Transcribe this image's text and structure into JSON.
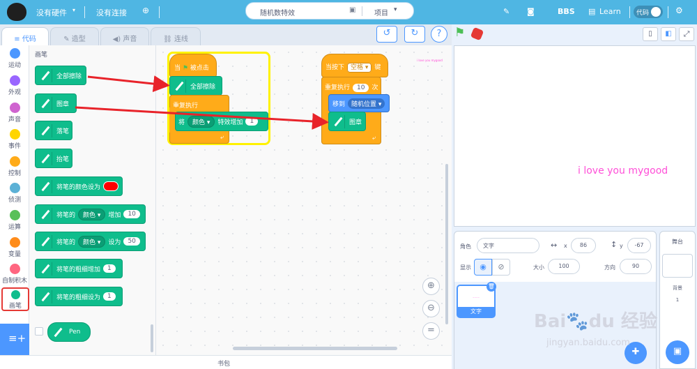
{
  "menu": {
    "hardware": "没有硬件",
    "connection": "没有连接",
    "project_title": "随机数特效",
    "project_menu": "项目",
    "bbs": "BBS",
    "learn": "Learn",
    "mode": "代码"
  },
  "tabs": {
    "code": "代码",
    "costumes": "造型",
    "sounds": "声音",
    "connect": "连线"
  },
  "categories": [
    {
      "label": "运动",
      "color": "#4c97ff"
    },
    {
      "label": "外观",
      "color": "#9966ff"
    },
    {
      "label": "声音",
      "color": "#cf63cf"
    },
    {
      "label": "事件",
      "color": "#ffd500"
    },
    {
      "label": "控制",
      "color": "#ffab19"
    },
    {
      "label": "侦测",
      "color": "#5cb1d6"
    },
    {
      "label": "运算",
      "color": "#59c059"
    },
    {
      "label": "变量",
      "color": "#ff8c1a"
    },
    {
      "label": "自制积木",
      "color": "#ff6680"
    },
    {
      "label": "画笔",
      "color": "#0fbd8c"
    }
  ],
  "palette": {
    "title": "画笔",
    "clear": "全部擦除",
    "stamp": "图章",
    "pen_down": "落笔",
    "pen_up": "抬笔",
    "set_color": "将笔的颜色设为",
    "change_prefix": "将笔的",
    "color_param": "颜色",
    "change_by": "增加",
    "change_val": "10",
    "set_to": "设为",
    "set_val": "50",
    "size_change": "将笔的粗细增加",
    "size_change_val": "1",
    "size_set": "将笔的粗细设为",
    "size_set_val": "1",
    "ext_pen": "Pen",
    "pen_color_value": "#ff0000"
  },
  "script1": {
    "hat_when": "当",
    "hat_clicked": "被点击",
    "clear": "全部擦除",
    "forever": "重复执行",
    "effect_prefix": "将",
    "effect_param": "颜色",
    "effect_by": "特效增加",
    "effect_val": "1"
  },
  "script2": {
    "hat_when": "当按下",
    "key": "空格",
    "hat_key": "键",
    "repeat": "重复执行",
    "repeat_val": "10",
    "repeat_times": "次",
    "goto": "移到",
    "goto_target": "随机位置",
    "stamp": "图章"
  },
  "stage": {
    "text": "i love you mygood",
    "text_color": "#ff4fd8"
  },
  "sprite_info": {
    "sprite_label": "角色",
    "sprite_name": "文字",
    "x_label": "x",
    "x_value": "86",
    "y_label": "y",
    "y_value": "-67",
    "show_label": "显示",
    "size_label": "大小",
    "size_value": "100",
    "direction_label": "方向",
    "direction_value": "90"
  },
  "sprite_thumb": {
    "name": "文字"
  },
  "stage_panel": {
    "title": "舞台",
    "backdrop_label": "背景",
    "backdrop_count": "1"
  },
  "backpack": {
    "label": "书包"
  },
  "watermark": {
    "line1": "Bai",
    "line2": "du",
    "line3": "经验",
    "line4": "jingyan.baidu.com"
  }
}
